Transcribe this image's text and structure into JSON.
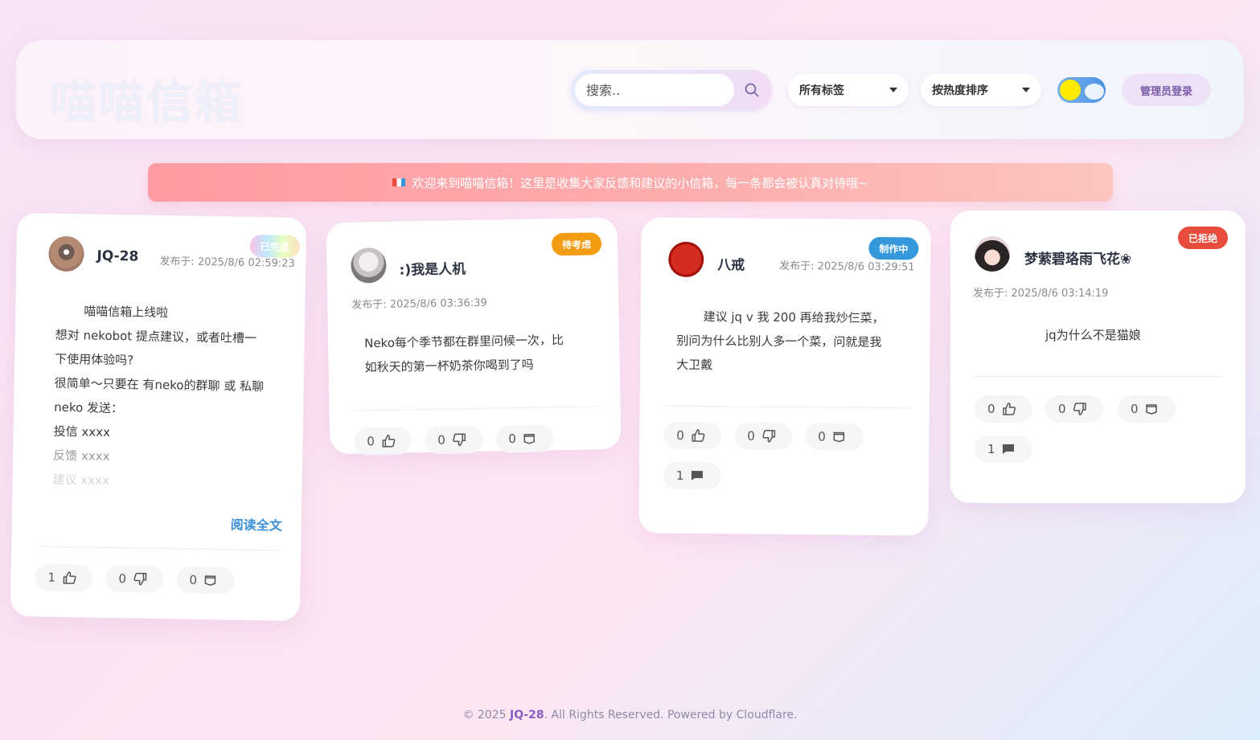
{
  "header": {
    "brand": "喵喵信箱",
    "search_placeholder": "搜索..",
    "tag_select": "所有标签",
    "sort_select": "按热度排序",
    "admin_login": "管理员登录"
  },
  "announcement": "欢迎来到喵喵信箱！这里是收集大家反馈和建议的小信箱，每一条都会被认真对待哦~",
  "cards": [
    {
      "author": "JQ-28",
      "date": "发布于: 2025/8/6 02:59:23",
      "status": "已完成",
      "lines": [
        "喵喵信箱上线啦",
        "想对 nekobot 提点建议，或者吐槽一",
        "下使用体验吗?",
        "很简单～只要在 有neko的群聊 或 私聊",
        "neko 发送：",
        "投信 xxxx",
        "反馈 xxxx",
        "建议 xxxx"
      ],
      "read_more": "阅读全文",
      "likes": "1",
      "dislikes": "0",
      "favorites": "0"
    },
    {
      "author": ":)我是人机",
      "date": "发布于: 2025/8/6 03:36:39",
      "status": "待考虑",
      "lines": [
        "Neko每个季节都在群里问候一次，比",
        "如秋天的第一杯奶茶你喝到了吗"
      ],
      "likes": "0",
      "dislikes": "0",
      "favorites": "0"
    },
    {
      "author": "八戒",
      "date": "发布于: 2025/8/6 03:29:51",
      "status": "制作中",
      "lines": [
        "建议 jq v 我 200 再给我炒仨菜，",
        "别问为什么比别人多一个菜，问就是我",
        "大卫戴"
      ],
      "likes": "0",
      "dislikes": "0",
      "favorites": "0",
      "comments": "1"
    },
    {
      "author": "梦萦碧珞雨飞花❀",
      "date": "发布于: 2025/8/6 03:14:19",
      "status": "已拒绝",
      "lines": [
        "jq为什么不是猫娘"
      ],
      "likes": "0",
      "dislikes": "0",
      "favorites": "0",
      "comments": "1"
    }
  ],
  "footer": {
    "prefix": "© 2025 ",
    "owner": "JQ-28",
    "suffix": ". All Rights Reserved. Powered by Cloudflare."
  },
  "colors": {
    "done": "#a8e6cf",
    "pending": "#f39c12",
    "in_progress": "#3498db",
    "rejected": "#e74c3c",
    "accent": "#3b8fd6"
  },
  "icons": [
    "search-icon",
    "thumbs-up-icon",
    "thumbs-down-icon",
    "bookmark-icon",
    "comment-icon",
    "flag-icon"
  ]
}
